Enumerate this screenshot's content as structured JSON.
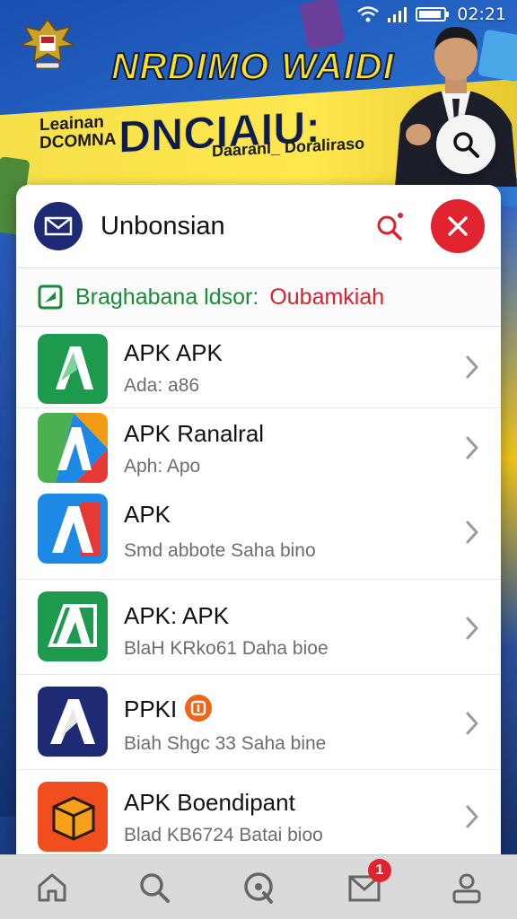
{
  "status_bar": {
    "time": "02:21",
    "wifi_icon": "wifi-icon",
    "signal_icon": "signal-icon",
    "battery_icon": "battery-icon"
  },
  "banner": {
    "title": "NRDIMO WAIDI",
    "sub_left_line1": "Leainan",
    "sub_left_line2": "DCOMNA",
    "big_text": "DNCIAIU:",
    "small_text": "Daaranl_ Doraliraso",
    "emblem_icon": "garuda-emblem-icon",
    "search_icon": "search-icon"
  },
  "dialog": {
    "logo_icon": "mail-icon",
    "title": "Unbonsian",
    "search_icon": "search-icon",
    "close_icon": "close-icon",
    "subheader": {
      "icon": "tag-icon",
      "label": "Braghabana ldsor:",
      "value": "Oubamkiah"
    },
    "apps": [
      {
        "name": "APK APK",
        "sub": "Ada: a86",
        "icon": "app-green-a-icon"
      },
      {
        "name": "APK Ranalral",
        "sub": "Aph: Apo",
        "icon": "app-multicolor-a-icon"
      },
      {
        "name": "APK",
        "sub": "Smd abbote    Saha bino",
        "icon": "app-blue-a-icon"
      },
      {
        "name": "APK: APK",
        "sub": "BlaH KRko61    Daha bioe",
        "icon": "app-green-box-icon"
      },
      {
        "name": "PPKI",
        "sub": "Biah Shgc 33    Saha bine",
        "icon": "app-navy-a-icon",
        "badge_icon": "orange-badge-icon"
      },
      {
        "name": "APK Boendipant",
        "sub": "Blad KB6724    Batai bioo",
        "icon": "app-orange-box-icon"
      }
    ]
  },
  "bottom_nav": {
    "items": [
      {
        "icon": "home-icon"
      },
      {
        "icon": "search-icon"
      },
      {
        "icon": "discover-icon"
      },
      {
        "icon": "inbox-icon",
        "badge": "1"
      },
      {
        "icon": "profile-icon"
      }
    ]
  },
  "colors": {
    "accent_red": "#e0232f",
    "accent_green": "#1b8a3a",
    "navy": "#1e2a73",
    "banner_yellow": "#ffe21a"
  }
}
